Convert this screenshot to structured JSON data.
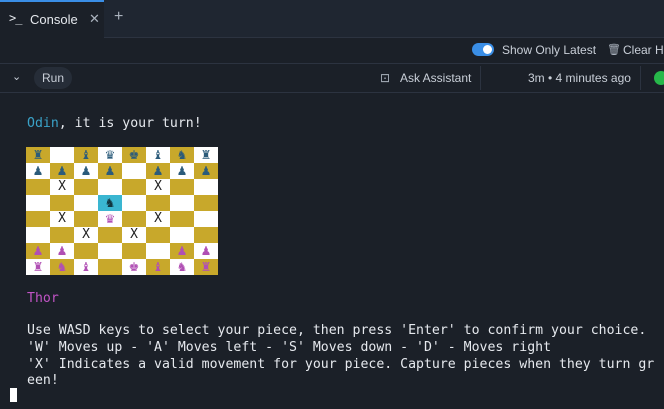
{
  "tabbar": {
    "tab_icon": ">_",
    "tab_label": "Console",
    "close_glyph": "✕",
    "add_glyph": "+"
  },
  "toolbar": {
    "toggle_on": true,
    "show_only_latest_label": "Show Only Latest",
    "clear_label": "Clear History"
  },
  "actionbar": {
    "run_label": "Run",
    "ask_assistant_label": "Ask Assistant",
    "time_label": "3m • 4 minutes ago",
    "status_color": "#27b84a"
  },
  "console": {
    "player1_name": "Odin",
    "turn_suffix": ", it is your turn!",
    "player2_name": "Thor",
    "instructions": [
      "Use WASD keys to select your piece, then press 'Enter' to confirm your choice.",
      "'W' Moves up - 'A' Moves left - 'S' Moves down - 'D' - Moves right",
      "'X' Indicates a valid movement for your piece. Capture pieces when they turn gr",
      "een!"
    ],
    "colors": {
      "player1": "#3aa3c9",
      "player2": "#c254c6",
      "board_light": "#ffffff",
      "board_dark": "#c8a82b",
      "selected": "#3ab6d1"
    }
  },
  "board": {
    "rows": [
      [
        "♜",
        "",
        "♝",
        "♛",
        "♚",
        "♝",
        "♞",
        "♜"
      ],
      [
        "♟",
        "♟",
        "♟",
        "♟",
        "",
        "♟",
        "♟",
        "♟"
      ],
      [
        "",
        "X",
        "",
        "",
        "",
        "X",
        "",
        ""
      ],
      [
        "",
        "",
        "",
        "♞",
        "",
        "",
        "",
        ""
      ],
      [
        "",
        "X",
        "",
        "♛",
        "",
        "X",
        "",
        ""
      ],
      [
        "",
        "",
        "X",
        "",
        "X",
        "",
        "",
        ""
      ],
      [
        "♟",
        "♟",
        "",
        "",
        "",
        "",
        "♟",
        "♟"
      ],
      [
        "♜",
        "♞",
        "♝",
        "",
        "♚",
        "♝",
        "♞",
        "♜"
      ]
    ]
  }
}
